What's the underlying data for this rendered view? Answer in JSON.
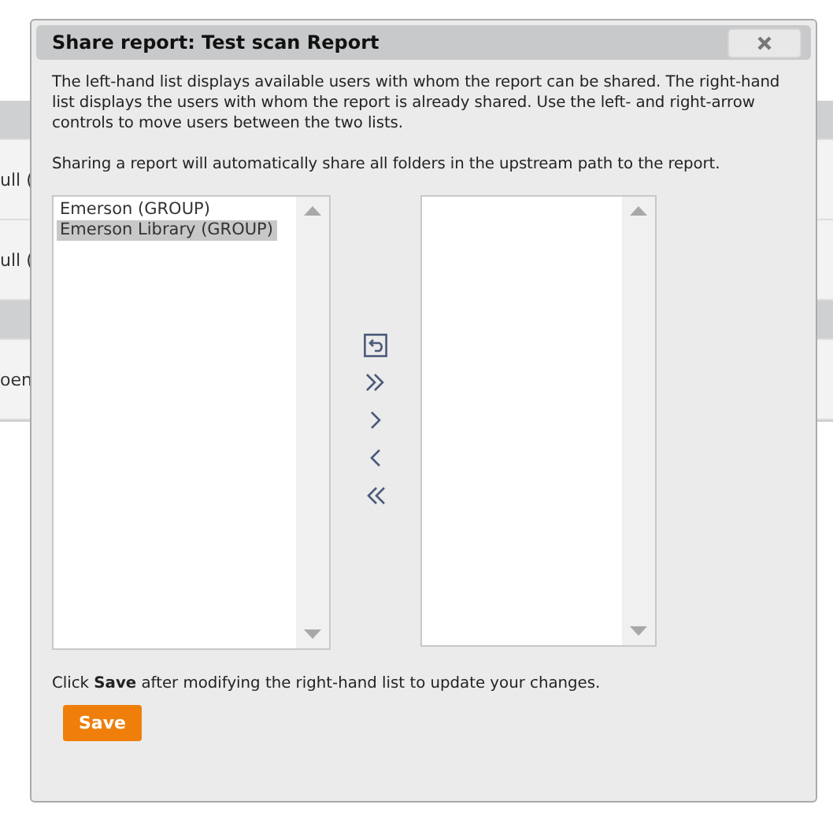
{
  "background": {
    "rows": [
      {
        "kind": "header"
      },
      {
        "kind": "row",
        "text": "ull ("
      },
      {
        "kind": "row",
        "text": "ull ("
      },
      {
        "kind": "header"
      },
      {
        "kind": "row",
        "text": "oen"
      }
    ]
  },
  "dialog": {
    "title": "Share report: Test scan Report",
    "paragraphs": [
      "The left-hand list displays available users with whom the report can be shared. The right-hand list displays the users with whom the report is already shared. Use the left- and right-arrow controls to move users between the two lists.",
      "Sharing a report will automatically share all folders in the upstream path to the report."
    ],
    "available": [
      {
        "label": "Emerson (GROUP)",
        "selected": false
      },
      {
        "label": "Emerson Library (GROUP)",
        "selected": true
      }
    ],
    "arrows": [
      {
        "kind": "reset"
      },
      {
        "kind": "all-right"
      },
      {
        "kind": "right"
      },
      {
        "kind": "left"
      },
      {
        "kind": "all-left"
      }
    ],
    "footer": "Click **Save** after modifying the right-hand list to update your changes.",
    "save": "Save"
  }
}
